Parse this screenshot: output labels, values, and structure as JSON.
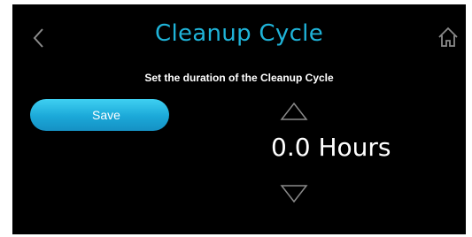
{
  "header": {
    "title": "Cleanup Cycle",
    "back_icon": "chevron-left-icon",
    "home_icon": "home-icon"
  },
  "instruction": "Set the duration of the Cleanup Cycle",
  "save_label": "Save",
  "duration": {
    "value": "0.0",
    "unit": "Hours",
    "increase_icon": "triangle-up-icon",
    "decrease_icon": "triangle-down-icon"
  },
  "colors": {
    "background": "#000000",
    "title": "#1fb3d8",
    "accent": "#1ba8d8",
    "icon": "#8a8a8a"
  }
}
